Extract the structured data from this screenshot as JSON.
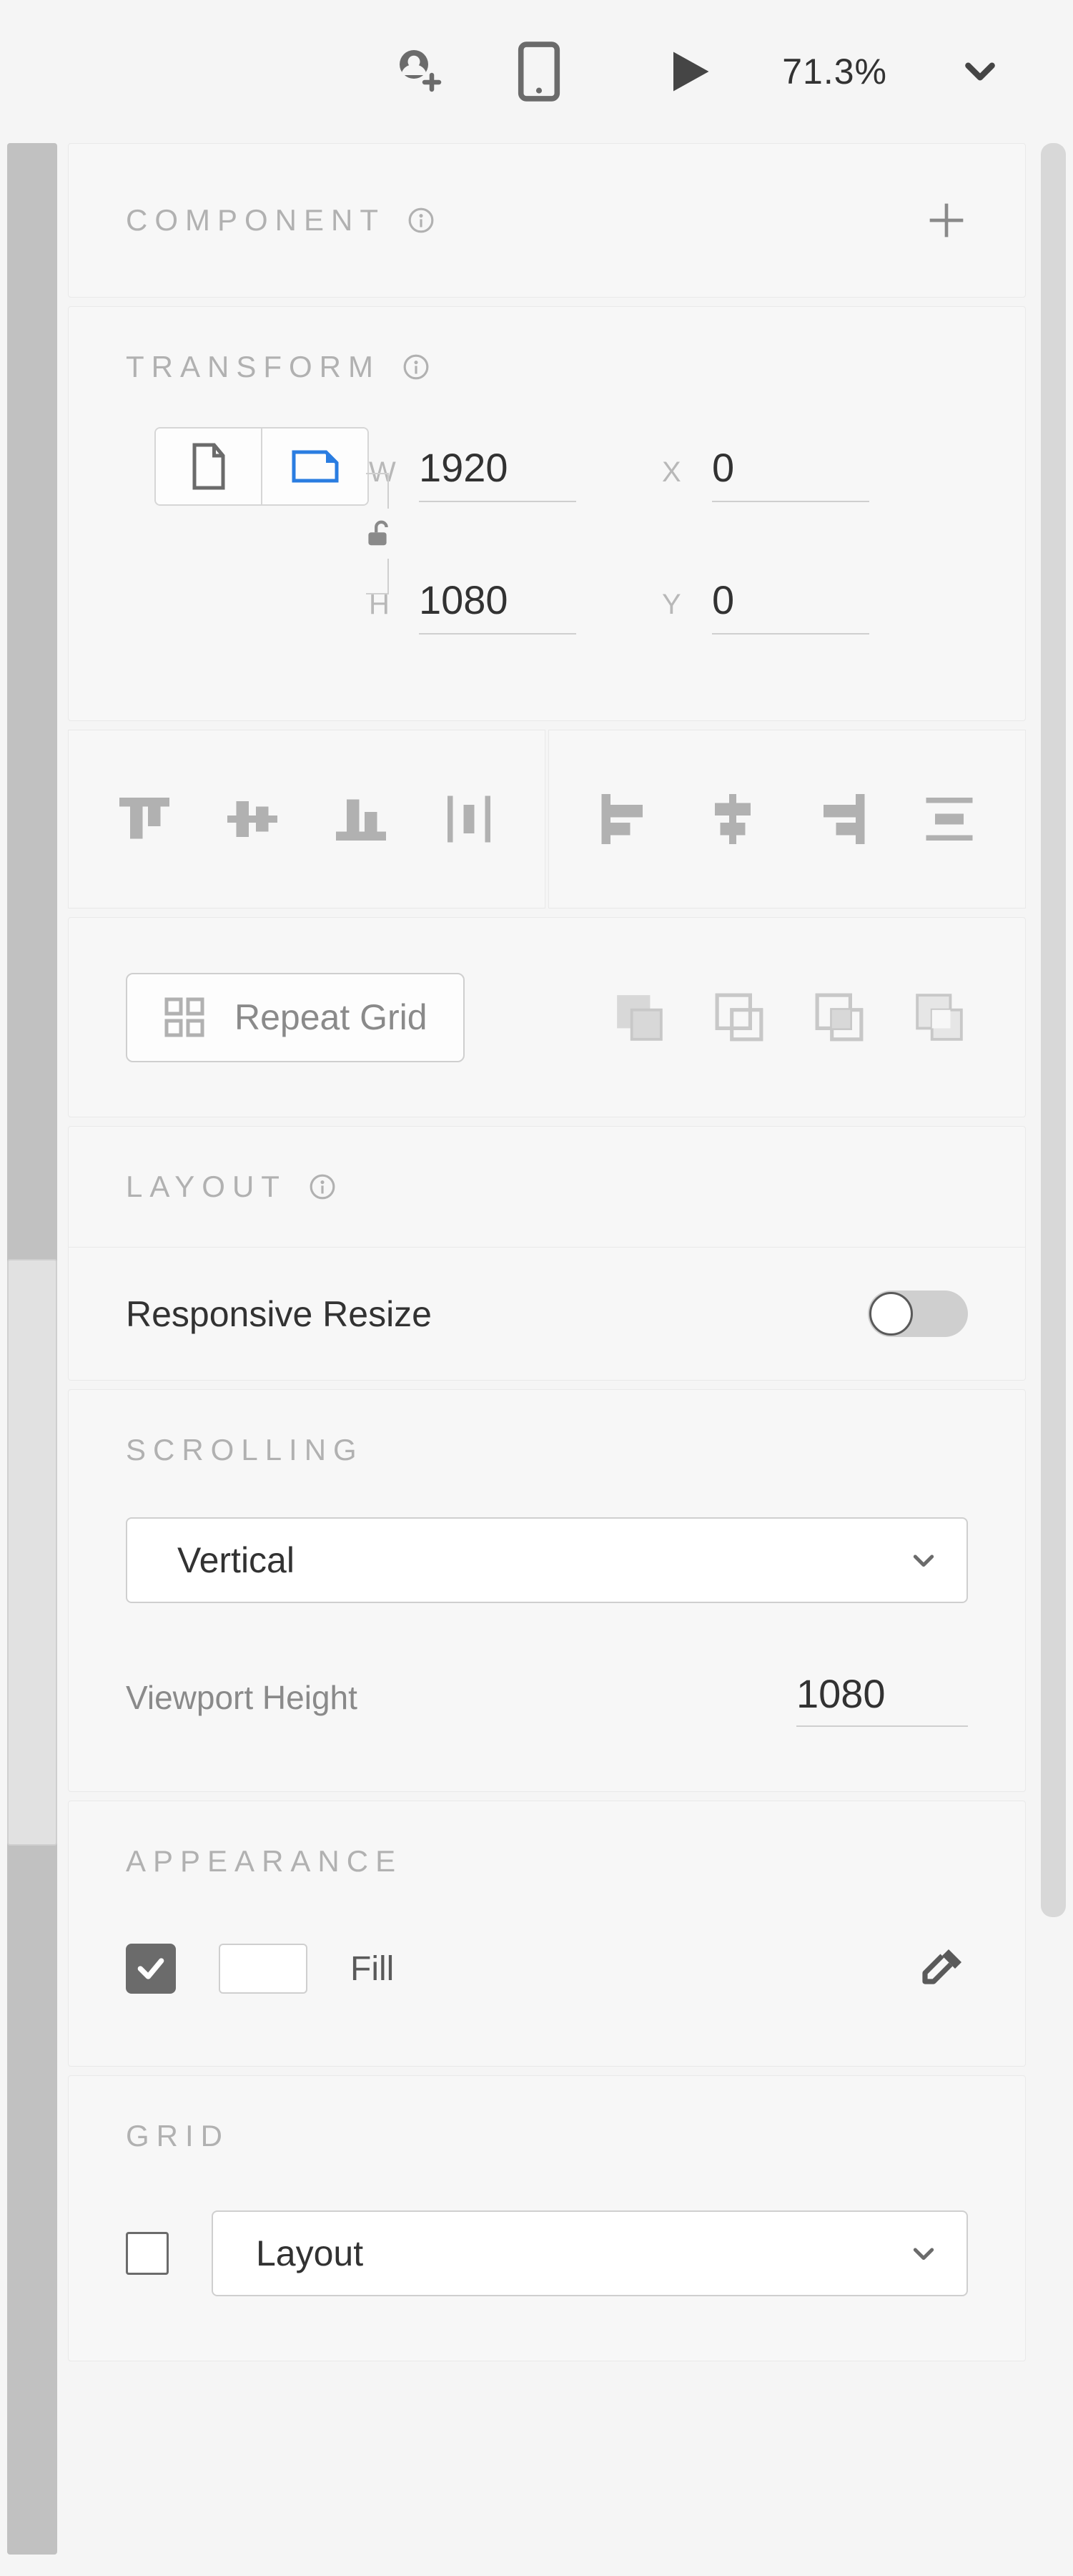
{
  "topbar": {
    "zoom": "71.3%"
  },
  "component": {
    "title": "Component"
  },
  "transform": {
    "title": "Transform",
    "w_label": "W",
    "h_label": "H",
    "x_label": "X",
    "y_label": "Y",
    "w": "1920",
    "h": "1080",
    "x": "0",
    "y": "0"
  },
  "repeat": {
    "label": "Repeat Grid"
  },
  "layout": {
    "title": "Layout",
    "responsive_label": "Responsive Resize",
    "responsive_on": false
  },
  "scrolling": {
    "title": "Scrolling",
    "direction": "Vertical",
    "viewport_label": "Viewport Height",
    "viewport_value": "1080"
  },
  "appearance": {
    "title": "Appearance",
    "fill_enabled": true,
    "fill_label": "Fill",
    "fill_color": "#FFFFFF"
  },
  "grid": {
    "title": "Grid",
    "enabled": false,
    "type": "Layout"
  }
}
